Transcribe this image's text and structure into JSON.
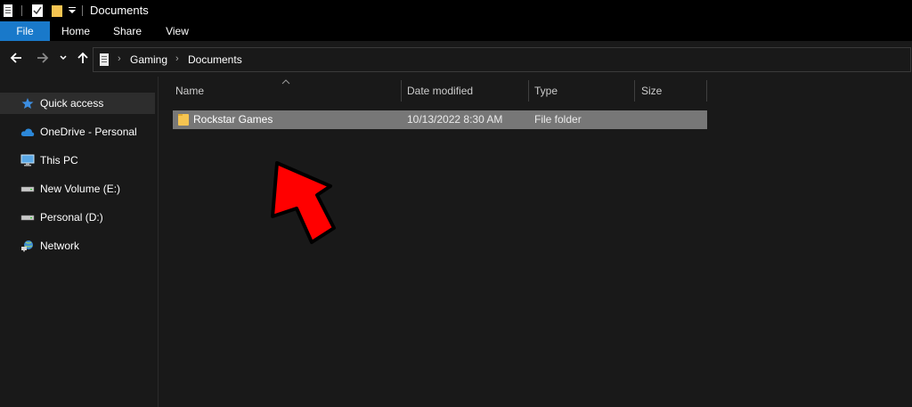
{
  "window": {
    "title": "Documents"
  },
  "ribbon": {
    "tabs": [
      "File",
      "Home",
      "Share",
      "View"
    ]
  },
  "address": {
    "crumbs": [
      "Gaming",
      "Documents"
    ]
  },
  "sidebar": {
    "items": [
      {
        "label": "Quick access",
        "icon": "star-icon"
      },
      {
        "label": "OneDrive - Personal",
        "icon": "cloud-icon"
      },
      {
        "label": "This PC",
        "icon": "monitor-icon"
      },
      {
        "label": "New Volume (E:)",
        "icon": "drive-icon"
      },
      {
        "label": "Personal (D:)",
        "icon": "drive-icon"
      },
      {
        "label": "Network",
        "icon": "network-icon"
      }
    ]
  },
  "file_list": {
    "columns": [
      "Name",
      "Date modified",
      "Type",
      "Size"
    ],
    "rows": [
      {
        "name": "Rockstar Games",
        "date": "10/13/2022 8:30 AM",
        "type": "File folder",
        "size": ""
      }
    ]
  },
  "colors": {
    "accent": "#1979ca",
    "folder": "#f5c451",
    "arrow": "#ff0000",
    "selection": "#777777"
  }
}
